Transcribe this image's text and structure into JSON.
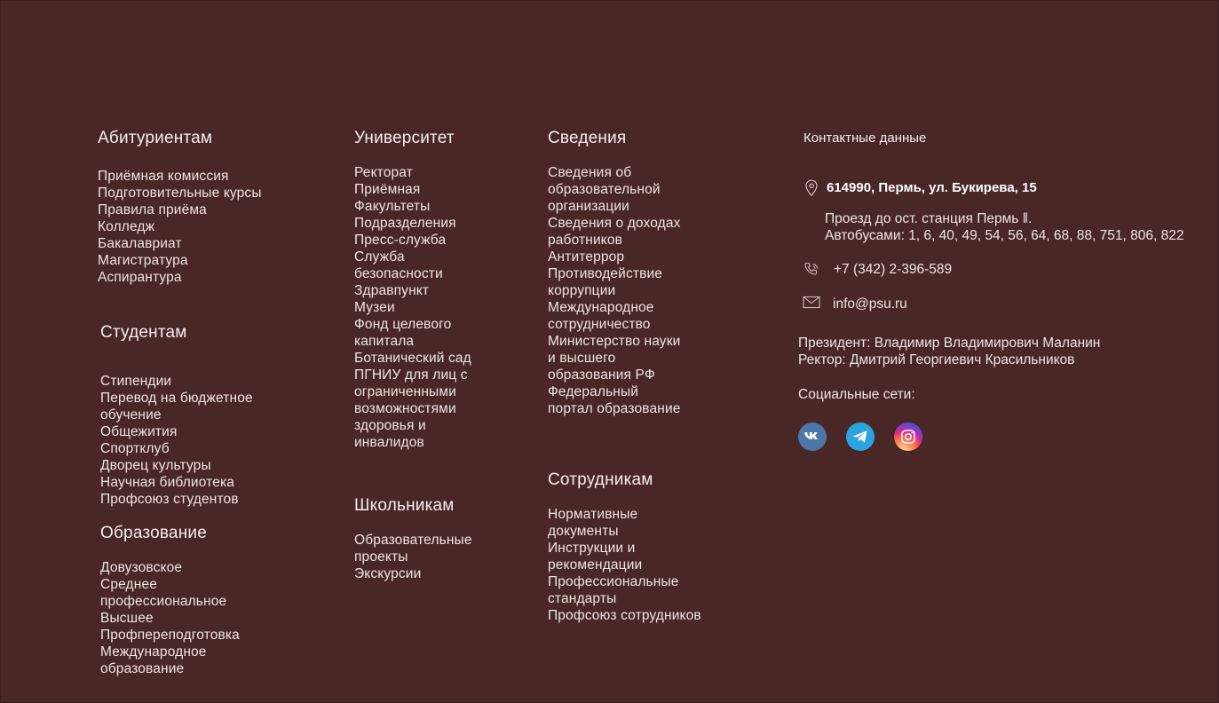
{
  "applicants": {
    "title": "Абитуриентам",
    "links": [
      "Приёмная комиссия",
      "Подготовительные курсы",
      "Правила приёма",
      "Колледж",
      "Бакалавриат",
      "Магистратура",
      "Аспирантура"
    ]
  },
  "students": {
    "title": "Студентам",
    "links": [
      "Стипендии",
      "Перевод на бюджетное обучение",
      "Общежития",
      "Спортклуб",
      "Дворец культуры",
      "Научная библиотека",
      "Профсоюз студентов"
    ]
  },
  "education": {
    "title": "Образование",
    "links": [
      "Довузовское",
      "Среднее профессиональное",
      "Высшее",
      "Профпереподготовка",
      "Международное образование"
    ]
  },
  "university": {
    "title": "Университет",
    "links": [
      "Ректорат",
      "Приёмная",
      "Факультеты",
      "Подразделения",
      "Пресс-служба",
      "Служба безопасности",
      "Здравпункт",
      "Музеи",
      "Фонд целевого капитала",
      "Ботанический сад",
      "ПГНИУ для лиц с ограниченными возможностями здоровья и инвалидов"
    ]
  },
  "schoolchildren": {
    "title": "Школьникам",
    "links": [
      "Образовательные проекты",
      "Экскурсии"
    ]
  },
  "info": {
    "title": "Сведения",
    "links": [
      "Сведения об образовательной организации",
      "Сведения о доходах работников",
      "Антитеррор",
      "Противодействие коррупции",
      "Международное сотрудничество",
      "Министерство науки и высшего образования РФ",
      "Федеральный портал образование"
    ]
  },
  "staff": {
    "title": "Сотрудникам",
    "links": [
      "Нормативные документы",
      "Инструкции и рекомендации",
      "Профессиональные стандарты",
      "Профсоюз сотрудников"
    ]
  },
  "contacts": {
    "title": "Контактные данные",
    "address": "614990, Пермь, ул. Букирева, 15",
    "directions_line1": "Проезд до ост. станция Пермь ǁ.",
    "directions_line2": "Автобусами: 1, 6, 40, 49, 54, 56, 64, 68, 88, 751, 806, 822",
    "phone": "+7 (342) 2-396-589",
    "email": "info@psu.ru",
    "president": "Президент: Владимир Владимирович Маланин",
    "rector": "Ректор: Дмитрий Георгиевич Красильников",
    "social_label": "Социальные сети:",
    "social": [
      {
        "name": "vk-icon",
        "color": "#4a76a8"
      },
      {
        "name": "telegram-icon",
        "color": "#2aa3e0"
      },
      {
        "name": "instagram-icon",
        "color": "#d6249f"
      }
    ]
  },
  "colors": {
    "background": "#4a2727",
    "text": "#efe3e3"
  }
}
